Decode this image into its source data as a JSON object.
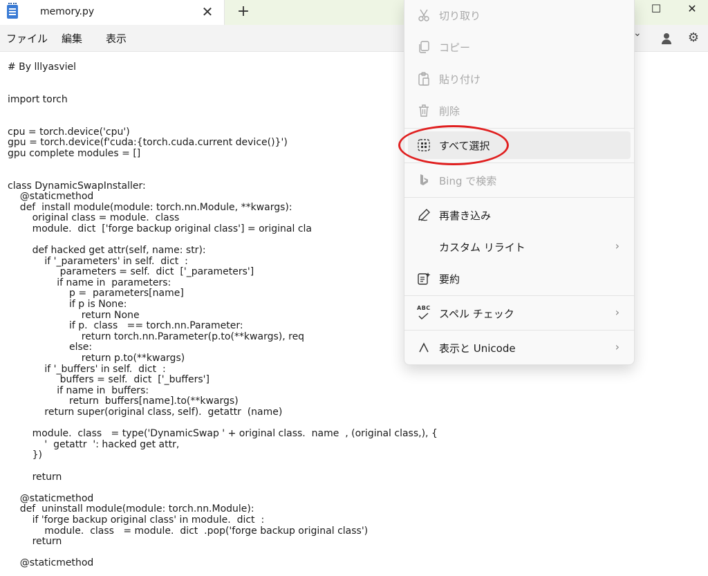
{
  "titlebar": {
    "tab_title": "memory.py",
    "close_tab": "✕",
    "new_tab": "+",
    "minimize": "—",
    "maximize": "☐",
    "close_window": "✕"
  },
  "menubar": {
    "file": "ファイル",
    "edit": "編集",
    "view": "表示",
    "dropdown_chevron": "⌄",
    "settings_icon": "⚙"
  },
  "code_lines": [
    "# By lllyasviel",
    "",
    "",
    "import torch",
    "",
    "",
    "cpu = torch.device('cpu')",
    "gpu = torch.device(f'cuda:{torch.cuda.current device()}')",
    "gpu complete modules = []",
    "",
    "",
    "class DynamicSwapInstaller:",
    "    @staticmethod",
    "    def  install module(module: torch.nn.Module, **kwargs):",
    "        original class = module.  class",
    "        module.  dict  ['forge backup original class'] = original cla",
    "",
    "        def hacked get attr(self, name: str):",
    "            if '_parameters' in self.  dict  :",
    "                 parameters = self.  dict  ['_parameters']",
    "                if name in  parameters:",
    "                    p =  parameters[name]",
    "                    if p is None:",
    "                        return None",
    "                    if p.  class   == torch.nn.Parameter:",
    "                        return torch.nn.Parameter(p.to(**kwargs), req",
    "                    else:",
    "                        return p.to(**kwargs)",
    "            if '_buffers' in self.  dict  :",
    "                 buffers = self.  dict  ['_buffers']",
    "                if name in  buffers:",
    "                    return  buffers[name].to(**kwargs)",
    "            return super(original class, self).  getattr  (name)",
    "",
    "        module.  class   = type('DynamicSwap ' + original class.  name  , (original class,), {",
    "            '  getattr  ': hacked get attr,",
    "        })",
    "",
    "        return",
    "",
    "    @staticmethod",
    "    def  uninstall module(module: torch.nn.Module):",
    "        if 'forge backup original class' in module.  dict  :",
    "            module.  class   = module.  dict  .pop('forge backup original class')",
    "        return",
    "",
    "    @staticmethod"
  ],
  "context_menu": {
    "cut": "切り取り",
    "copy": "コピー",
    "paste": "貼り付け",
    "delete": "削除",
    "select_all": "すべて選択",
    "bing_search": "Bing で検索",
    "rewrite": "再書き込み",
    "custom_rewrite": "カスタム リライト",
    "summarize": "要約",
    "spell_check": "スペル チェック",
    "display_unicode": "表示と Unicode",
    "spell_icon_text": "ABC",
    "chevron": "›"
  },
  "colors": {
    "titlebar": "#eef5e4",
    "annotation_circle": "#e02020",
    "highlight": "#ececec"
  }
}
